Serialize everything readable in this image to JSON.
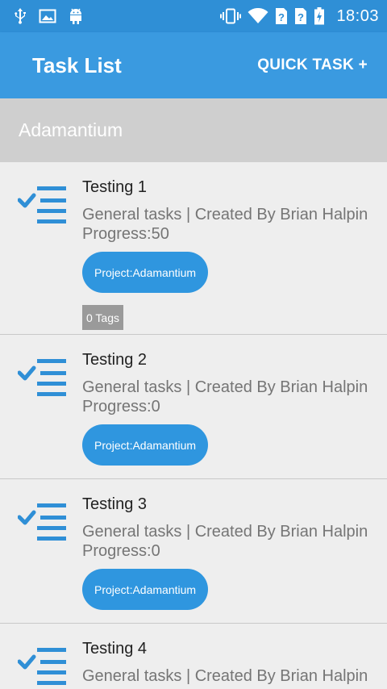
{
  "status_bar": {
    "time": "18:03",
    "left_icons": [
      "usb-icon",
      "image-icon",
      "android-icon"
    ],
    "right_icons": [
      "vibrate-icon",
      "wifi-icon",
      "sim-unknown-icon",
      "sim-unknown-icon",
      "battery-charging-icon"
    ]
  },
  "app_bar": {
    "title": "Task List",
    "quick_task_label": "QUICK TASK +"
  },
  "section": {
    "title": "Adamantium"
  },
  "tasks": [
    {
      "title": "Testing 1",
      "meta": "General tasks | Created By Brian Halpin",
      "progress": "Progress:50",
      "project": "Project:Adamantium",
      "tags": "0 Tags"
    },
    {
      "title": "Testing 2",
      "meta": "General tasks | Created By Brian Halpin",
      "progress": "Progress:0",
      "project": "Project:Adamantium"
    },
    {
      "title": "Testing 3",
      "meta": "General tasks | Created By Brian Halpin",
      "progress": "Progress:0",
      "project": "Project:Adamantium"
    },
    {
      "title": "Testing 4",
      "meta": "General tasks | Created By Brian Halpin"
    }
  ],
  "colors": {
    "status_bar": "#2f8fd6",
    "app_bar": "#3a9ae0",
    "section_header": "#cfcfcf",
    "chip": "#2f96df",
    "tags_badge": "#9a9a9a",
    "task_icon": "#2f8fd6"
  }
}
